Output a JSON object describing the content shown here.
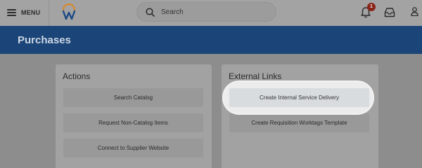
{
  "header": {
    "menu_label": "MENU",
    "search_placeholder": "Search",
    "notification_count": "1"
  },
  "page": {
    "title": "Purchases"
  },
  "actions": {
    "title": "Actions",
    "buttons": [
      "Search Catalog",
      "Request Non-Catalog Items",
      "Connect to Supplier Website"
    ]
  },
  "external_links": {
    "title": "External Links",
    "buttons": [
      "Create Internal Service Delivery",
      "Create Requisition Worktags Template"
    ]
  },
  "colors": {
    "brand_blue": "#1b4578",
    "notification_red": "#8a2418",
    "logo_orange": "#d8882b"
  }
}
